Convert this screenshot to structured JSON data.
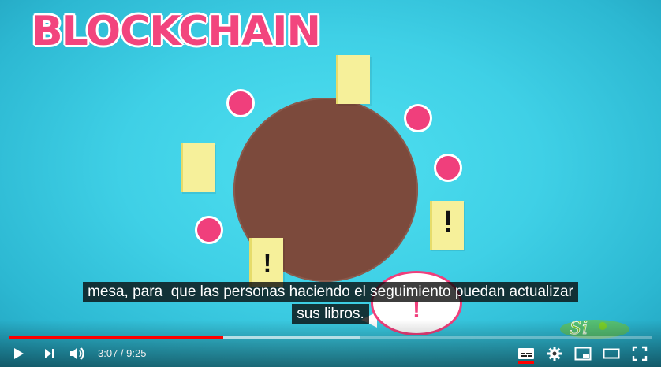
{
  "video": {
    "title_text": "BLOCKCHAIN",
    "book_marks": [
      "!",
      "!"
    ],
    "bubble_mark": "!",
    "colors": {
      "background": "#3fd0e6",
      "table": "#7c4a3c",
      "person": "#f03f7c",
      "book": "#f6f09a",
      "title": "#f2457e"
    }
  },
  "captions": {
    "line1": "mesa, para  que las personas haciendo el seguimiento puedan actualizar",
    "line2": "sus libros."
  },
  "watermark": {
    "icon": "sci-show-logo"
  },
  "player": {
    "progress_played": 0.333,
    "progress_loaded": 0.545,
    "time_current": "3:07",
    "time_separator": " / ",
    "time_total": "9:25",
    "icons": {
      "play": "play-icon",
      "next": "next-icon",
      "volume": "volume-icon",
      "subtitles": "subtitles-icon",
      "settings": "settings-icon",
      "miniplayer": "miniplayer-icon",
      "theater": "theater-icon",
      "fullscreen": "fullscreen-icon"
    },
    "accent": "#ff0000"
  }
}
